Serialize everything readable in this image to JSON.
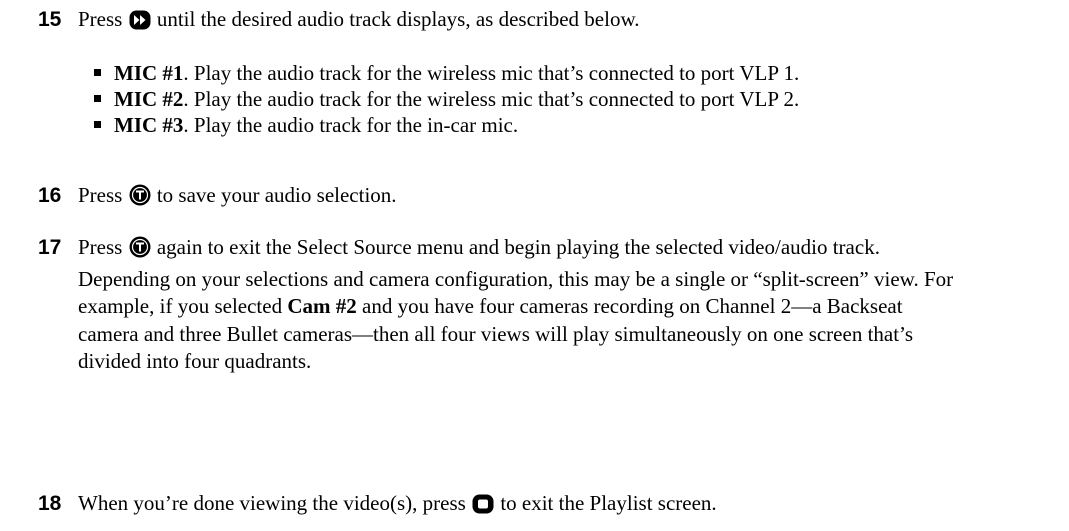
{
  "steps": [
    {
      "number": "15",
      "before": "Press",
      "icon": "fast-forward-button-icon",
      "after": "until the desired audio track displays, as described below.",
      "bullets": [
        {
          "term": "MIC #1",
          "text": ". Play the audio track for the wireless mic that’s connected to port VLP 1."
        },
        {
          "term": "MIC #2",
          "text": ". Play the audio track for the wireless mic that’s connected to port VLP 2."
        },
        {
          "term": "MIC #3",
          "text": ". Play the audio track for the in-car mic."
        }
      ]
    },
    {
      "number": "16",
      "before": "Press",
      "icon": "t-button-icon",
      "after": "to save your audio selection."
    },
    {
      "number": "17",
      "before": "Press",
      "icon": "t-button-icon",
      "after_1": "again to exit the Select Source menu and begin playing the selected video/audio track. Depending on your selections and camera configuration, this may be a single or “split-screen” view. For example, if you selected ",
      "bold": "Cam #2",
      "after_2": " and you have four cameras recording on Channel 2—a Backseat camera and three Bullet cameras—then all four views will play simultaneously on one screen that’s divided into four quadrants."
    },
    {
      "number": "18",
      "before": "When you’re done viewing the video(s), press",
      "icon": "stop-button-icon",
      "after": "to exit the Playlist screen."
    }
  ]
}
